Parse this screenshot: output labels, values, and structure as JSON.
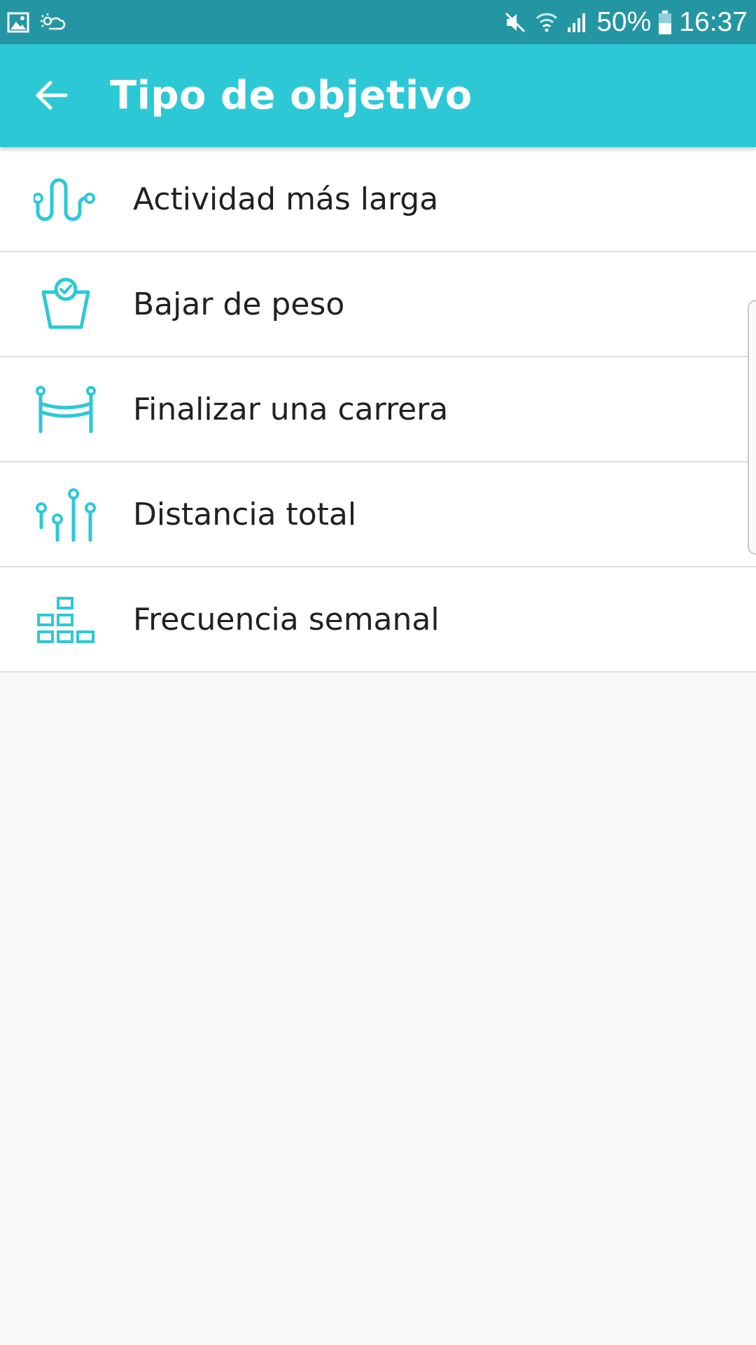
{
  "status_bar": {
    "battery": "50%",
    "time": "16:37",
    "icons": [
      "gallery-icon",
      "weather-icon",
      "mute-icon",
      "wifi-icon",
      "signal-icon",
      "battery-icon"
    ]
  },
  "app_bar": {
    "title": "Tipo de objetivo",
    "back_icon": "arrow-left-icon"
  },
  "goals": [
    {
      "label": "Actividad más larga",
      "icon": "activity-wave-icon"
    },
    {
      "label": "Bajar de peso",
      "icon": "scale-icon"
    },
    {
      "label": "Finalizar una carrera",
      "icon": "finish-line-icon"
    },
    {
      "label": "Distancia total",
      "icon": "distance-pins-icon"
    },
    {
      "label": "Frecuencia semanal",
      "icon": "weekly-blocks-icon"
    }
  ],
  "colors": {
    "status_bar": "#2496a3",
    "app_bar": "#2dc8d6",
    "accent_icon": "#2dc8d6",
    "text": "#212121",
    "background": "#f9f9f9"
  }
}
